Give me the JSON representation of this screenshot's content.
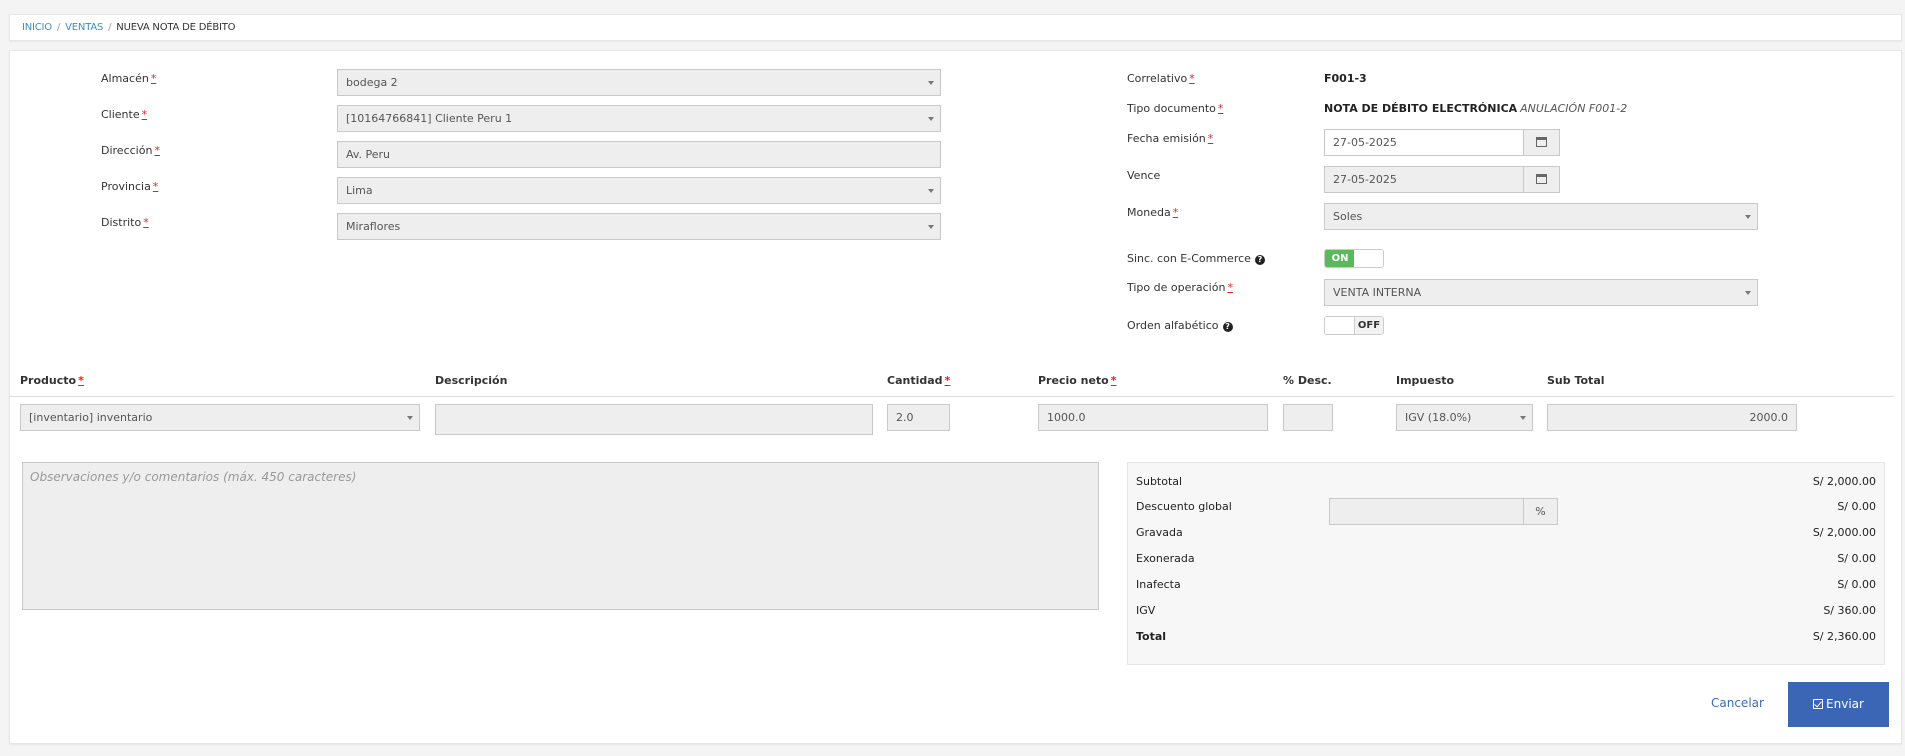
{
  "breadcrumb": {
    "items": [
      "INICIO",
      "VENTAS"
    ],
    "current": "NUEVA NOTA DE DÉBITO"
  },
  "left": {
    "almacen": {
      "label": "Almacén",
      "value": "bodega 2"
    },
    "cliente": {
      "label": "Cliente",
      "value": "[10164766841] Cliente Peru 1"
    },
    "direccion": {
      "label": "Dirección",
      "value": "Av. Peru"
    },
    "provincia": {
      "label": "Provincia",
      "value": "Lima"
    },
    "distrito": {
      "label": "Distrito",
      "value": "Miraflores"
    }
  },
  "right": {
    "correlativo": {
      "label": "Correlativo",
      "value": "F001-3"
    },
    "tipo_documento": {
      "label": "Tipo documento",
      "value": "NOTA DE DÉBITO ELECTRÓNICA",
      "note": "ANULACIÓN F001-2"
    },
    "fecha_emision": {
      "label": "Fecha emisión",
      "value": "27-05-2025"
    },
    "vence": {
      "label": "Vence",
      "value": "27-05-2025"
    },
    "moneda": {
      "label": "Moneda",
      "value": "Soles"
    },
    "sinc_ecommerce": {
      "label": "Sinc. con E-Commerce",
      "state": "ON"
    },
    "tipo_operacion": {
      "label": "Tipo de operación",
      "value": "VENTA INTERNA"
    },
    "orden_alfabetico": {
      "label": "Orden alfabético",
      "state": "OFF"
    }
  },
  "table": {
    "headers": {
      "producto": "Producto",
      "descripcion": "Descripción",
      "cantidad": "Cantidad",
      "precio_neto": "Precio neto",
      "desc": "% Desc.",
      "impuesto": "Impuesto",
      "subtotal": "Sub Total"
    },
    "row": {
      "producto": "[inventario] inventario",
      "descripcion": "",
      "cantidad": "2.0",
      "precio_neto": "1000.0",
      "desc": "",
      "impuesto": "IGV (18.0%)",
      "subtotal": "2000.0"
    }
  },
  "observaciones": {
    "placeholder": "Observaciones y/o comentarios (máx. 450 caracteres)"
  },
  "totals": {
    "subtotal": {
      "label": "Subtotal",
      "value": "S/ 2,000.00"
    },
    "descuento_global": {
      "label": "Descuento global",
      "value": "S/ 0.00",
      "addon": "%"
    },
    "gravada": {
      "label": "Gravada",
      "value": "S/ 2,000.00"
    },
    "exonerada": {
      "label": "Exonerada",
      "value": "S/ 0.00"
    },
    "inafecta": {
      "label": "Inafecta",
      "value": "S/ 0.00"
    },
    "igv": {
      "label": "IGV",
      "value": "S/ 360.00"
    },
    "total": {
      "label": "Total",
      "value": "S/ 2,360.00"
    }
  },
  "actions": {
    "cancel": "Cancelar",
    "submit": "Enviar"
  },
  "icons": {
    "calendar": "calendar-icon",
    "help": "question-circle-icon",
    "check": "check-square-icon"
  },
  "colors": {
    "link": "#3b8dd1",
    "primary_button": "#3b65b5",
    "toggle_on": "#5cb85c",
    "required": "#e02222"
  }
}
